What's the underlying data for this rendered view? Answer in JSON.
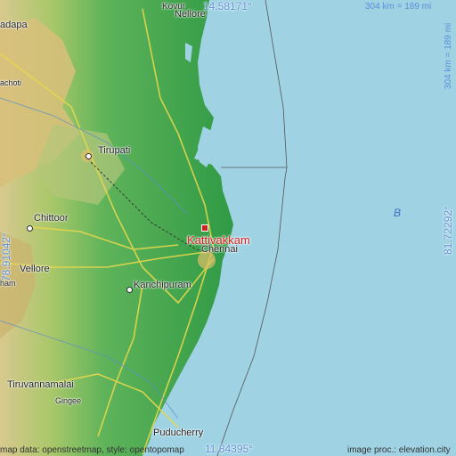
{
  "place": {
    "name": "Kattivakkam",
    "color": "#d62020"
  },
  "coordinates": {
    "top_lat": "14.58171°",
    "bottom_lat": "11.84395°",
    "left_lon": "78.91042°",
    "right_lon": "81.72292°"
  },
  "scale": {
    "horizontal": "304 km = 189 mi",
    "vertical": "304 km = 189 mi"
  },
  "cities": [
    {
      "key": "nellore",
      "label": "Nellore"
    },
    {
      "key": "kovur",
      "label": "Kovur"
    },
    {
      "key": "kadapa",
      "label": "adapa"
    },
    {
      "key": "tirupati",
      "label": "Tirupati"
    },
    {
      "key": "chittoor",
      "label": "Chittoor"
    },
    {
      "key": "vellore",
      "label": "Vellore"
    },
    {
      "key": "kanchipuram",
      "label": "Kanchipuram"
    },
    {
      "key": "chennai",
      "label": "Chennai"
    },
    {
      "key": "tiruvannamalai",
      "label": "Tiruvannamalai"
    },
    {
      "key": "gingee",
      "label": "Gingee"
    },
    {
      "key": "puducherry",
      "label": "Puducherry"
    },
    {
      "key": "rachoti",
      "label": "achoti"
    },
    {
      "key": "ambur",
      "label": "ham"
    }
  ],
  "sea_label": "B",
  "credits": {
    "left": "map data: openstreetmap, style: opentopomap",
    "right": "image proc.: elevation.city"
  },
  "colors": {
    "sea": "#9fd3e4",
    "lowland": "#3da24a",
    "upland": "#8fc25a",
    "hills": "#d8c07a",
    "coord": "#5b8fd6"
  }
}
